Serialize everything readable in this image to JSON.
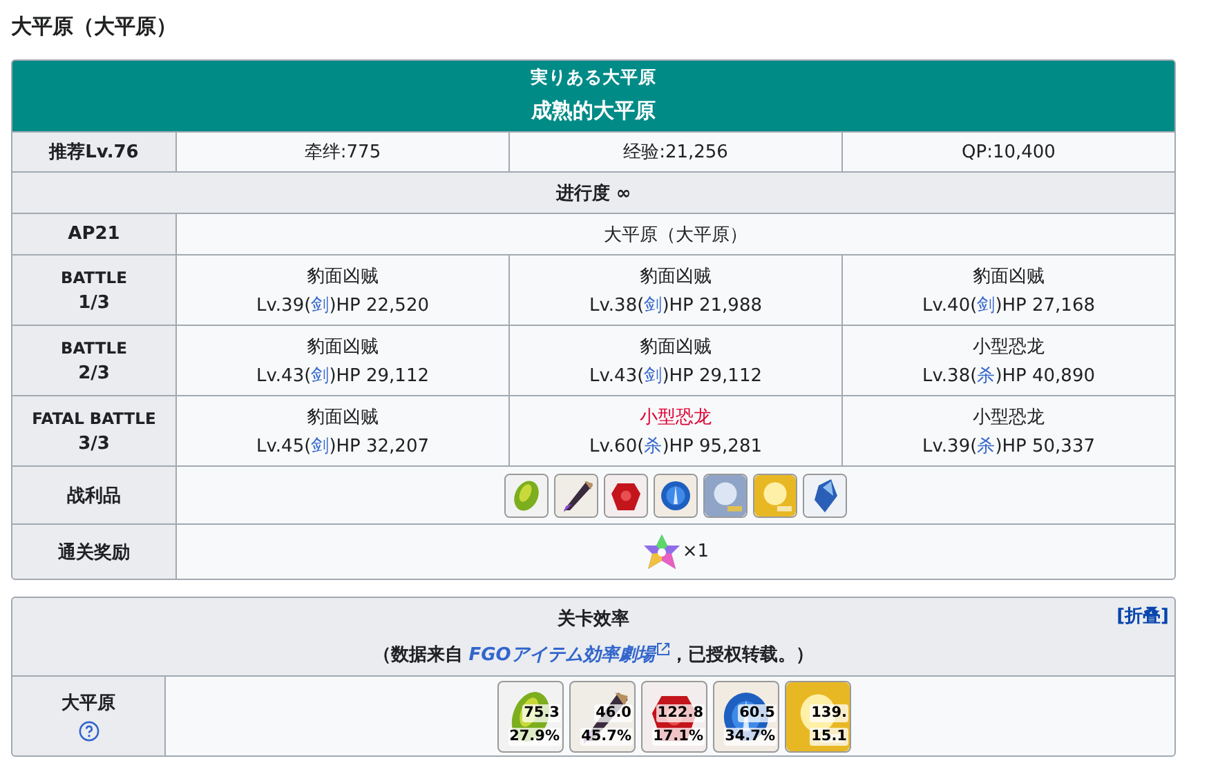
{
  "page_title": "大平原（大平原）",
  "quest": {
    "title_jp": "実りある大平原",
    "title_cn": "成熟的大平原",
    "info": {
      "label": "推荐Lv.76",
      "cells": [
        "牵绊:775",
        "经验:21,256",
        "QP:10,400"
      ]
    },
    "progress": "进行度 ∞",
    "ap": {
      "label": "AP21",
      "location": "大平原（大平原）"
    },
    "battles": [
      {
        "label_top": "BATTLE",
        "label_bottom": "1/3",
        "enemies": [
          {
            "name": "豹面凶贼",
            "boss": false,
            "before": "Lv.39(",
            "class": "剑",
            "after": ")HP 22,520"
          },
          {
            "name": "豹面凶贼",
            "boss": false,
            "before": "Lv.38(",
            "class": "剑",
            "after": ")HP 21,988"
          },
          {
            "name": "豹面凶贼",
            "boss": false,
            "before": "Lv.40(",
            "class": "剑",
            "after": ")HP 27,168"
          }
        ]
      },
      {
        "label_top": "BATTLE",
        "label_bottom": "2/3",
        "enemies": [
          {
            "name": "豹面凶贼",
            "boss": false,
            "before": "Lv.43(",
            "class": "剑",
            "after": ")HP 29,112"
          },
          {
            "name": "豹面凶贼",
            "boss": false,
            "before": "Lv.43(",
            "class": "剑",
            "after": ")HP 29,112"
          },
          {
            "name": "小型恐龙",
            "boss": false,
            "before": "Lv.38(",
            "class": "杀",
            "after": ")HP 40,890"
          }
        ]
      },
      {
        "label_top": "FATAL BATTLE",
        "label_bottom": "3/3",
        "enemies": [
          {
            "name": "豹面凶贼",
            "boss": false,
            "before": "Lv.45(",
            "class": "剑",
            "after": ")HP 32,207"
          },
          {
            "name": "小型恐龙",
            "boss": true,
            "before": "Lv.60(",
            "class": "杀",
            "after": ")HP 95,281"
          },
          {
            "name": "小型恐龙",
            "boss": false,
            "before": "Lv.39(",
            "class": "杀",
            "after": ")HP 50,337"
          }
        ]
      }
    ],
    "drops": {
      "label": "战利品",
      "items": [
        {
          "kind": "seed"
        },
        {
          "kind": "fang"
        },
        {
          "kind": "gem"
        },
        {
          "kind": "orb"
        },
        {
          "kind": "silver_card"
        },
        {
          "kind": "gold_card"
        },
        {
          "kind": "crystal"
        }
      ]
    },
    "reward": {
      "label": "通关奖励",
      "count": "×1"
    }
  },
  "efficiency": {
    "title": "关卡效率",
    "toggle": "[折叠]",
    "source_before": "（数据来自",
    "source_link": "FGOアイテム効率劇場",
    "source_after": "，已授权转载。）",
    "row_label": "大平原",
    "items": [
      {
        "kind": "seed",
        "value": "75.3",
        "rate": "27.9%"
      },
      {
        "kind": "fang",
        "value": "46.0",
        "rate": "45.7%"
      },
      {
        "kind": "gem",
        "value": "122.8",
        "rate": "17.1%"
      },
      {
        "kind": "orb",
        "value": "60.5",
        "rate": "34.7%"
      },
      {
        "kind": "gold_card",
        "value": "139.",
        "rate": "15.1"
      }
    ]
  }
}
